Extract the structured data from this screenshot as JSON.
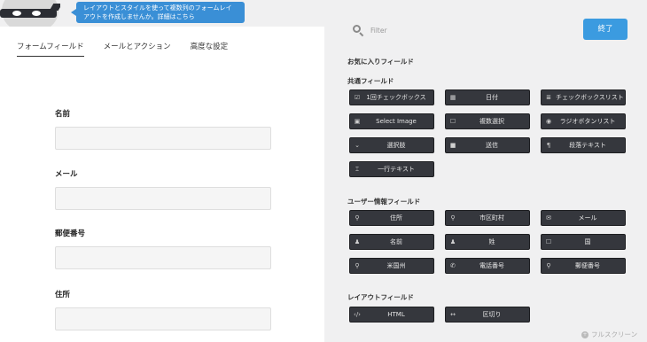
{
  "promo": {
    "text": "レイアウトとスタイルを使って複数列のフォームレイアウトを作成しませんか。詳細はこちら"
  },
  "tabs": [
    {
      "label": "フォームフィールド"
    },
    {
      "label": "メールとアクション"
    },
    {
      "label": "高度な設定"
    }
  ],
  "form_fields": [
    {
      "label": "名前"
    },
    {
      "label": "メール"
    },
    {
      "label": "郵便番号"
    },
    {
      "label": "住所"
    }
  ],
  "filter": {
    "placeholder": "Filter"
  },
  "done_label": "終了",
  "sections": {
    "favorites": "お気に入りフィールド",
    "common": "共通フィールド",
    "user": "ユーザー情報フィールド",
    "layout": "レイアウトフィールド"
  },
  "common_fields": [
    {
      "label": "1回チェックボックス",
      "icon": "checkbox-icon"
    },
    {
      "label": "日付",
      "icon": "calendar-icon"
    },
    {
      "label": "チェックボックスリスト",
      "icon": "list-icon"
    },
    {
      "label": "Select Image",
      "icon": "image-icon"
    },
    {
      "label": "複数選択",
      "icon": "square-icon"
    },
    {
      "label": "ラジオボタンリスト",
      "icon": "radio-icon"
    },
    {
      "label": "選択肢",
      "icon": "chevron-down-icon"
    },
    {
      "label": "送信",
      "icon": "square-filled-icon"
    },
    {
      "label": "段落テキスト",
      "icon": "paragraph-icon"
    },
    {
      "label": "一行テキスト",
      "icon": "text-cursor-icon"
    }
  ],
  "user_fields": [
    {
      "label": "住所",
      "icon": "map-pin-icon"
    },
    {
      "label": "市区町村",
      "icon": "map-pin-icon"
    },
    {
      "label": "メール",
      "icon": "envelope-icon"
    },
    {
      "label": "名前",
      "icon": "user-icon"
    },
    {
      "label": "姓",
      "icon": "user-icon"
    },
    {
      "label": "国",
      "icon": "square-icon"
    },
    {
      "label": "米国州",
      "icon": "map-pin-icon"
    },
    {
      "label": "電話番号",
      "icon": "phone-icon"
    },
    {
      "label": "郵便番号",
      "icon": "map-pin-icon"
    }
  ],
  "layout_fields": [
    {
      "label": "HTML",
      "icon": "code-icon"
    },
    {
      "label": "区切り",
      "icon": "divider-icon"
    }
  ],
  "fullscreen_label": "フルスクリーン"
}
